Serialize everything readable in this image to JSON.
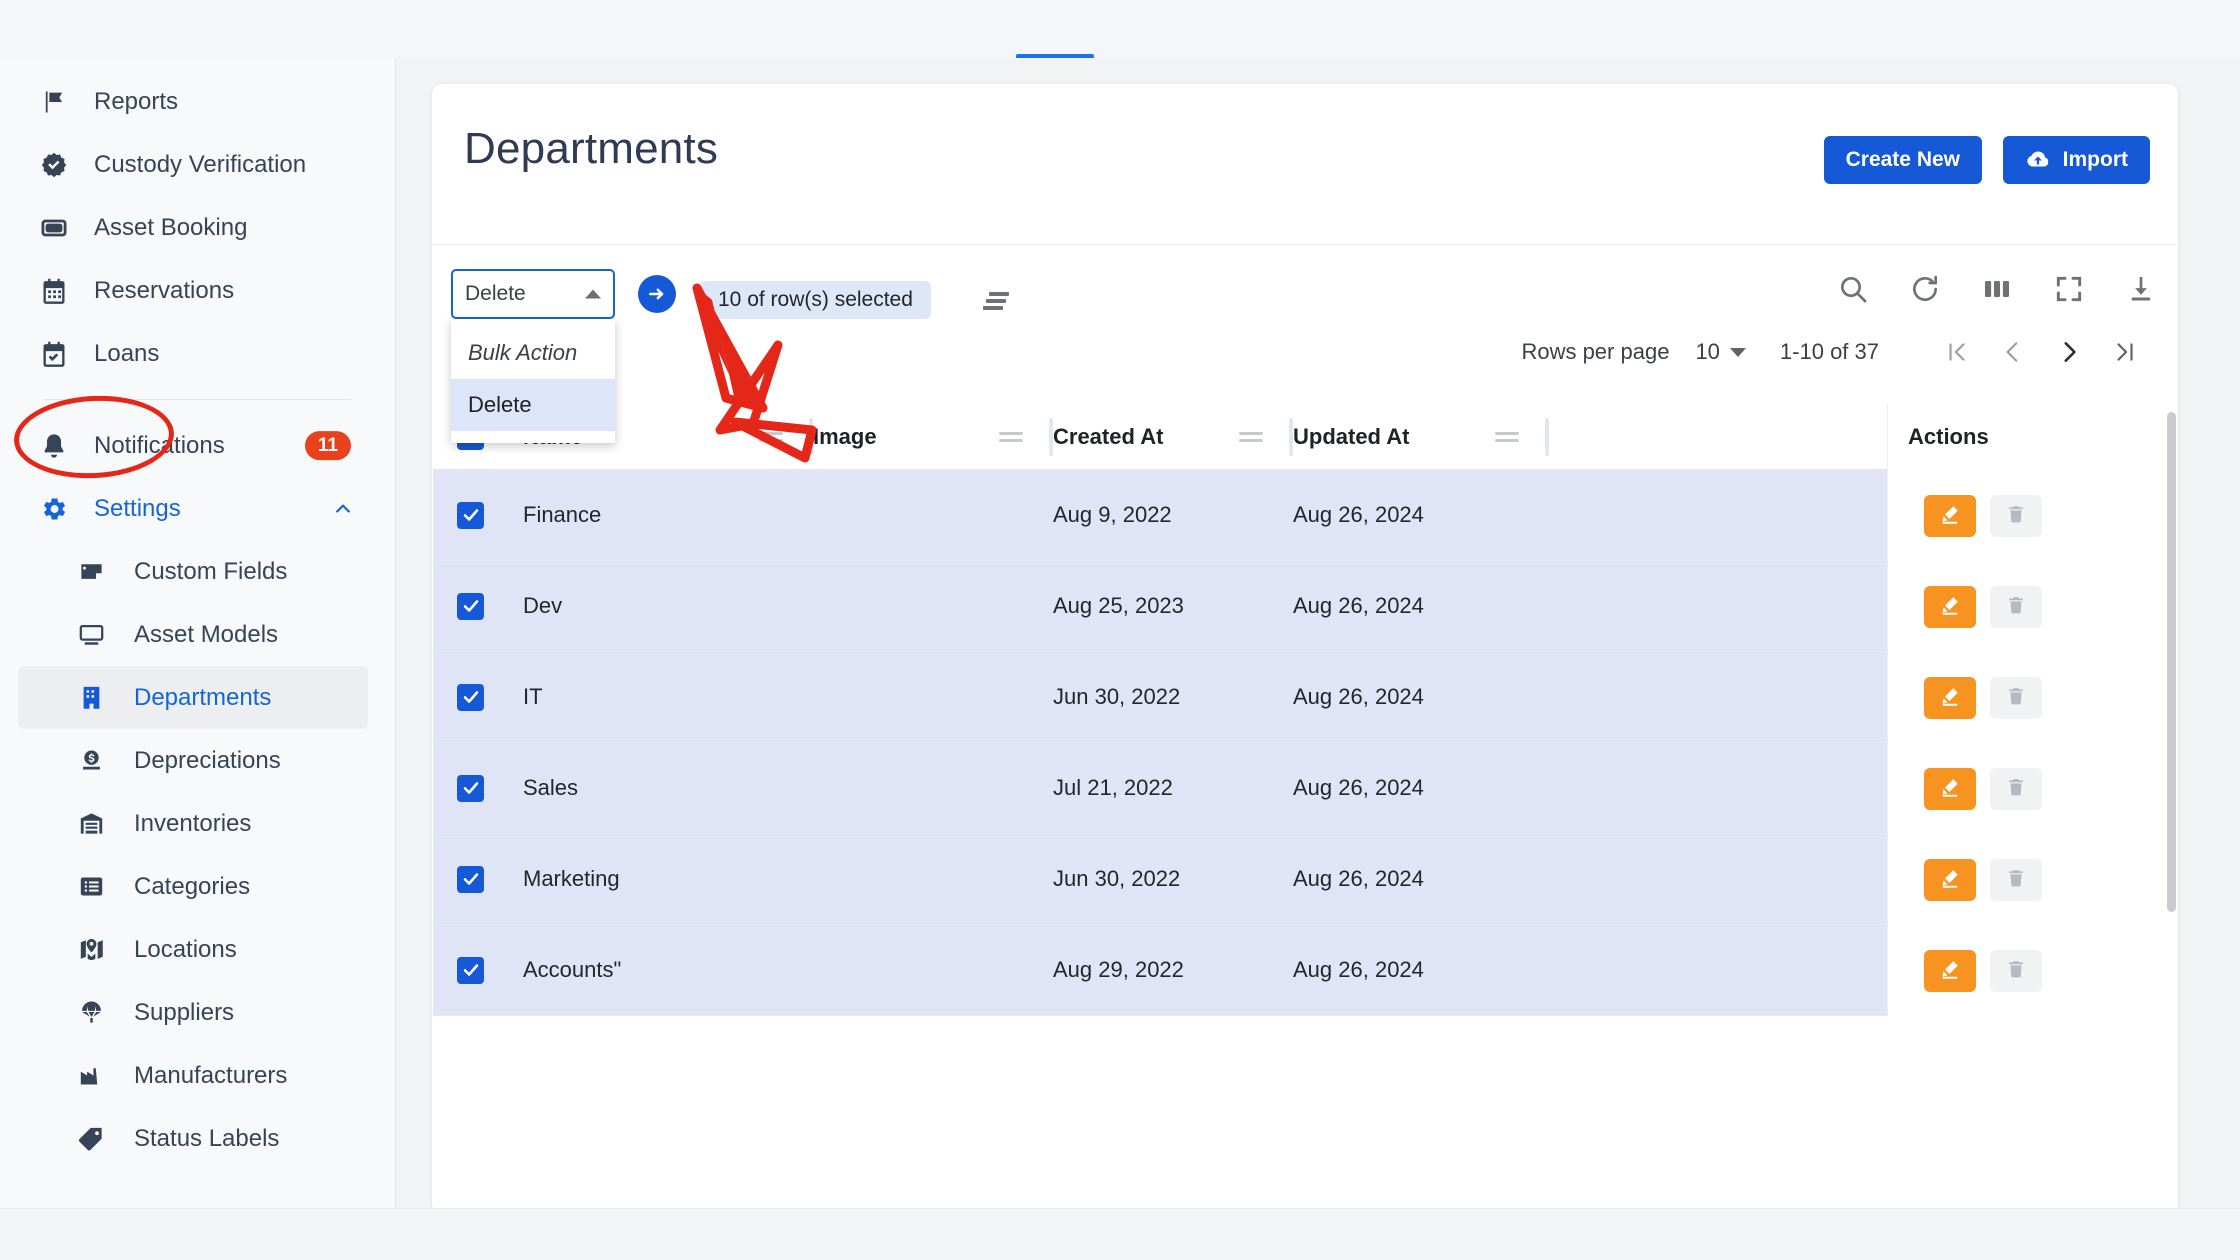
{
  "browser": {
    "active_tab_indicator": true
  },
  "sidebar": {
    "items": [
      {
        "label": "Reports",
        "icon": "flag-icon",
        "type": "top"
      },
      {
        "label": "Custody Verification",
        "icon": "badge-check-icon",
        "type": "top"
      },
      {
        "label": "Asset Booking",
        "icon": "ticket-icon",
        "type": "top"
      },
      {
        "label": "Reservations",
        "icon": "calendar-icon",
        "type": "top"
      },
      {
        "label": "Loans",
        "icon": "calendar-check-icon",
        "type": "top"
      }
    ],
    "notifications": {
      "label": "Notifications",
      "icon": "bell-icon",
      "badge": "11"
    },
    "settings": {
      "label": "Settings",
      "icon": "gear-icon",
      "expanded": true,
      "chevron": "chevron-up-icon"
    },
    "sub_items": [
      {
        "label": "Custom Fields",
        "icon": "custom-fields-icon",
        "active": false
      },
      {
        "label": "Asset Models",
        "icon": "monitor-icon",
        "active": false
      },
      {
        "label": "Departments",
        "icon": "building-icon",
        "active": true
      },
      {
        "label": "Depreciations",
        "icon": "coin-icon",
        "active": false
      },
      {
        "label": "Inventories",
        "icon": "warehouse-icon",
        "active": false
      },
      {
        "label": "Categories",
        "icon": "list-icon",
        "active": false
      },
      {
        "label": "Locations",
        "icon": "map-pin-icon",
        "active": false
      },
      {
        "label": "Suppliers",
        "icon": "parachute-icon",
        "active": false
      },
      {
        "label": "Manufacturers",
        "icon": "factory-icon",
        "active": false
      },
      {
        "label": "Status Labels",
        "icon": "tag-icon",
        "active": false
      }
    ]
  },
  "header": {
    "title": "Departments",
    "create_label": "Create New",
    "import_label": "Import",
    "import_icon": "cloud-upload-icon"
  },
  "toolbar": {
    "bulk_select_value": "Delete",
    "dropdown_open": true,
    "dropdown_options": [
      {
        "label": "Bulk Action",
        "placeholder": true,
        "selected": false
      },
      {
        "label": "Delete",
        "placeholder": false,
        "selected": true
      }
    ],
    "go_icon": "arrow-right-circle-icon",
    "selection_text": "10 of row(s) selected",
    "sort_icon": "sort-lines-icon",
    "icons": [
      {
        "name": "search-icon"
      },
      {
        "name": "refresh-icon"
      },
      {
        "name": "columns-icon"
      },
      {
        "name": "fullscreen-icon"
      },
      {
        "name": "download-icon"
      }
    ]
  },
  "pagination": {
    "rows_per_page_label": "Rows per page",
    "rows_per_page_value": "10",
    "range_text": "1-10 of 37",
    "first_icon": "first-page-icon",
    "prev_icon": "prev-page-icon",
    "next_icon": "next-page-icon",
    "last_icon": "last-page-icon"
  },
  "table": {
    "header_checkbox_checked": true,
    "columns": [
      {
        "key": "name",
        "label": "Name"
      },
      {
        "key": "image",
        "label": "Image"
      },
      {
        "key": "created_at",
        "label": "Created At"
      },
      {
        "key": "updated_at",
        "label": "Updated At"
      },
      {
        "key": "actions",
        "label": "Actions"
      }
    ],
    "rows": [
      {
        "checked": true,
        "name": "Finance",
        "image": "",
        "created_at": "Aug 9, 2022",
        "updated_at": "Aug 26, 2024"
      },
      {
        "checked": true,
        "name": "Dev",
        "image": "",
        "created_at": "Aug 25, 2023",
        "updated_at": "Aug 26, 2024"
      },
      {
        "checked": true,
        "name": "IT",
        "image": "",
        "created_at": "Jun 30, 2022",
        "updated_at": "Aug 26, 2024"
      },
      {
        "checked": true,
        "name": "Sales",
        "image": "",
        "created_at": "Jul 21, 2022",
        "updated_at": "Aug 26, 2024"
      },
      {
        "checked": true,
        "name": "Marketing",
        "image": "",
        "created_at": "Jun 30, 2022",
        "updated_at": "Aug 26, 2024"
      },
      {
        "checked": true,
        "name": "Accounts\"",
        "image": "",
        "created_at": "Aug 29, 2022",
        "updated_at": "Aug 26, 2024"
      }
    ],
    "row_actions": {
      "edit_icon": "pencil-icon",
      "delete_icon": "trash-icon"
    }
  },
  "annotations": {
    "ellipse_target": "Settings",
    "arrow_color": "#e5271a",
    "arrow_count": 3
  },
  "colors": {
    "primary": "#1559d6",
    "accent_orange": "#f79421",
    "badge_red": "#e8411c",
    "selected_row": "#dfe4f7",
    "sidebar_text": "#374357",
    "annotation_red": "#e5271a"
  }
}
